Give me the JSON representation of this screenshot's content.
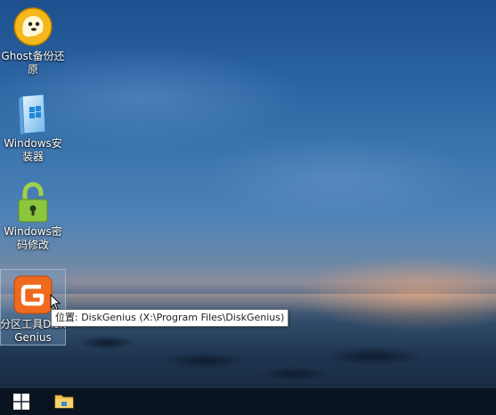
{
  "desktop": {
    "icons": [
      {
        "label": "Ghost备份还原",
        "icon": "ghost-icon"
      },
      {
        "label": "Windows安装器",
        "icon": "windows-installer-icon"
      },
      {
        "label": "Windows密码修改",
        "icon": "password-lock-icon"
      },
      {
        "label": "分区工具DiskGenius",
        "icon": "diskgenius-icon",
        "selected": true
      }
    ]
  },
  "tooltip": {
    "text": "位置: DiskGenius (X:\\Program Files\\DiskGenius)"
  },
  "taskbar": {
    "start_icon": "windows-logo-icon",
    "pinned": [
      {
        "icon": "file-explorer-icon"
      }
    ]
  },
  "colors": {
    "taskbar": "#0a121e",
    "selection": "#78a0c8",
    "diskgenius_orange": "#f06a1e",
    "lock_green": "#8cc63f"
  }
}
